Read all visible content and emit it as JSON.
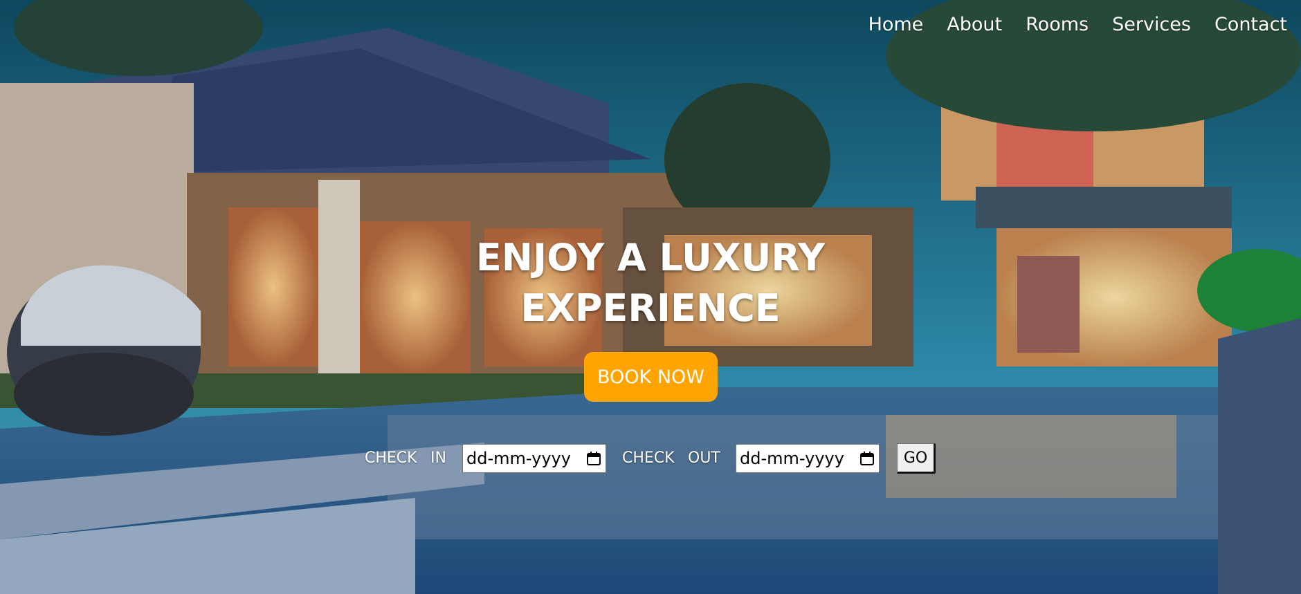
{
  "nav": {
    "items": [
      {
        "label": "Home"
      },
      {
        "label": "About"
      },
      {
        "label": "Rooms"
      },
      {
        "label": "Services"
      },
      {
        "label": "Contact"
      }
    ]
  },
  "hero": {
    "title_line1": "ENJOY A LUXURY",
    "title_line2": "EXPERIENCE",
    "book_button": "BOOK NOW"
  },
  "booking": {
    "check_word": "CHECK",
    "in_word": "IN",
    "out_word": "OUT",
    "checkin_placeholder": "dd-mm-yyyy",
    "checkout_placeholder": "dd-mm-yyyy",
    "go_label": "GO"
  },
  "colors": {
    "accent": "#ffa400",
    "text": "#ffffff"
  },
  "icons": {
    "date_picker": "calendar-icon"
  }
}
